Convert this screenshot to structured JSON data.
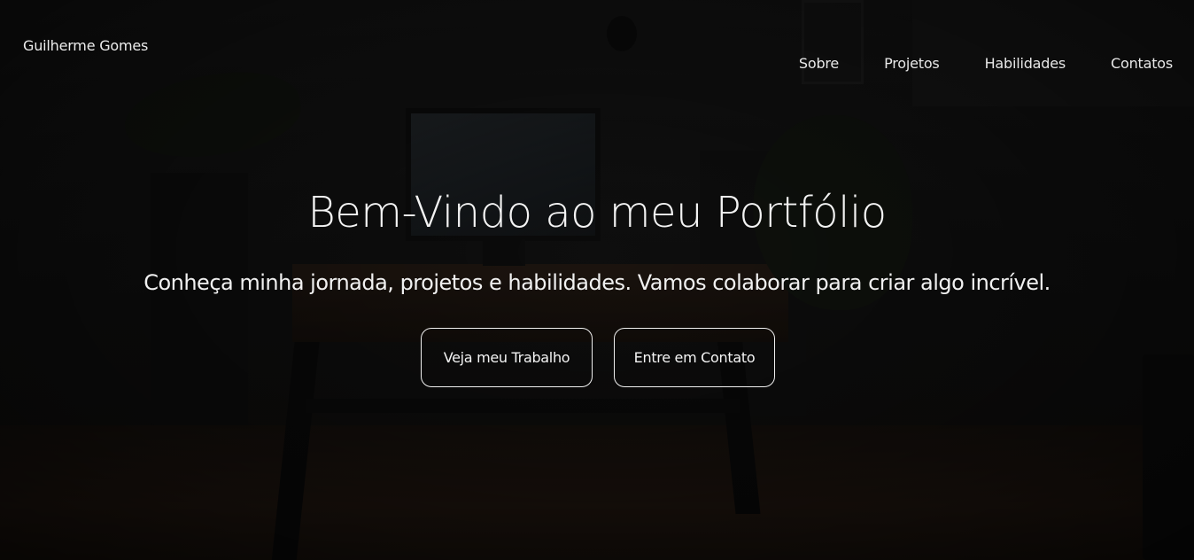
{
  "header": {
    "brand": "Guilherme Gomes",
    "nav": [
      {
        "label": "Sobre"
      },
      {
        "label": "Projetos"
      },
      {
        "label": "Habilidades"
      },
      {
        "label": "Contatos"
      }
    ]
  },
  "hero": {
    "title": "Bem-Vindo ao meu Portfólio",
    "subtitle": "Conheça minha jornada, projetos e habilidades. Vamos colaborar para criar algo incrível.",
    "buttons": {
      "primary": "Veja meu Trabalho",
      "secondary": "Entre em Contato"
    }
  },
  "colors": {
    "text": "#f2f2f2",
    "background": "#0d0d0d",
    "button_border": "#f0f0f0"
  }
}
